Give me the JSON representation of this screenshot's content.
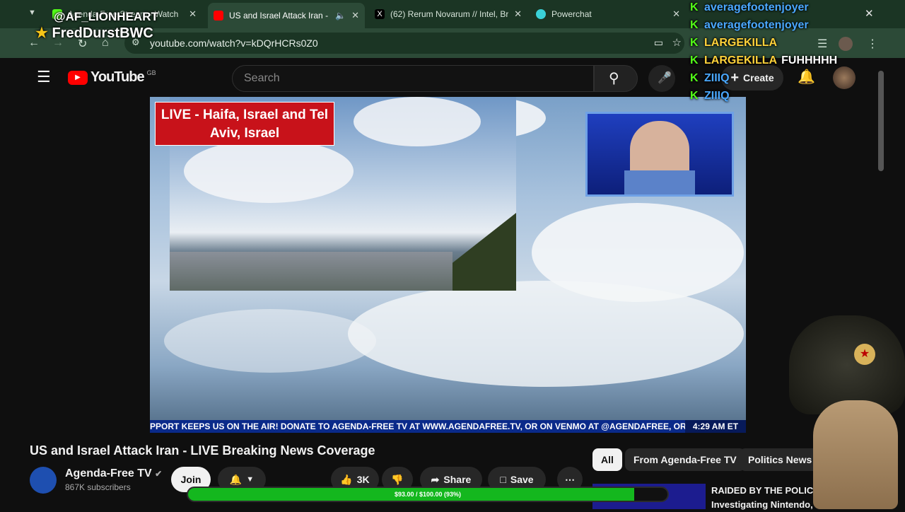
{
  "browser": {
    "tabs": [
      {
        "label": "Agenda-Free Stream - Watch",
        "favicon": "kick-icon",
        "active": false
      },
      {
        "label": "US and Israel Attack Iran - LIVE",
        "favicon": "youtube-icon",
        "active": true
      },
      {
        "label": "(62) Rerum Novarum // Intel, Br",
        "favicon": "x-icon",
        "active": false
      },
      {
        "label": "Powerchat",
        "favicon": "powerchat-icon",
        "active": false
      }
    ],
    "url": "youtube.com/watch?v=kDQrHCRs0Z0"
  },
  "youtube": {
    "logo_text": "YouTube",
    "region": "GB",
    "search_placeholder": "Search",
    "create_label": "Create"
  },
  "video": {
    "live_caption": "LIVE - Haifa, Israel and Tel Aviv, Israel",
    "ticker_text": "PPORT KEEPS US ON THE AIR! DONATE TO AGENDA-FREE TV AT WWW.AGENDAFREE.TV, OR ON VENMO AT @AGENDAFREE, OR CLI",
    "ticker_time": "4:29 AM ET",
    "title": "US and Israel Attack Iran - LIVE Breaking News Coverage"
  },
  "channel": {
    "name": "Agenda-Free TV",
    "subscribers": "867K subscribers",
    "join_label": "Join"
  },
  "actions": {
    "likes": "3K",
    "share_label": "Share",
    "save_label": "Save"
  },
  "chips": [
    "All",
    "From Agenda-Free TV",
    "Politics News"
  ],
  "related": {
    "title_line1": "RAIDED BY THE POLICE",
    "title_line2": "Investigating Nintendo, S"
  },
  "stream_overlay": {
    "top_names": [
      "@AF_LIONHEART",
      "FredDurstBWC"
    ],
    "chat": [
      {
        "user": "averagefootenjoyer",
        "msg": "",
        "color": "#4aa8ff"
      },
      {
        "user": "averagefootenjoyer",
        "msg": "",
        "color": "#4aa8ff"
      },
      {
        "user": "LARGEKILLA",
        "msg": "",
        "color": "#ffd23a"
      },
      {
        "user": "LARGEKILLA",
        "msg": "FUHHHHH",
        "color": "#ffd23a"
      },
      {
        "user": "ZIIIQ",
        "msg": "",
        "color": "#4aa8ff"
      },
      {
        "user": "ZIIIQ",
        "msg": "",
        "color": "#4aa8ff"
      }
    ],
    "goal_text": "$93.00 / $100.00 (93%)",
    "goal_fraction": 0.93
  },
  "colors": {
    "browser_frame": "#1b3524",
    "kick_green": "#53fc18",
    "goal_green": "#14b71e",
    "live_red": "#c8121a"
  }
}
